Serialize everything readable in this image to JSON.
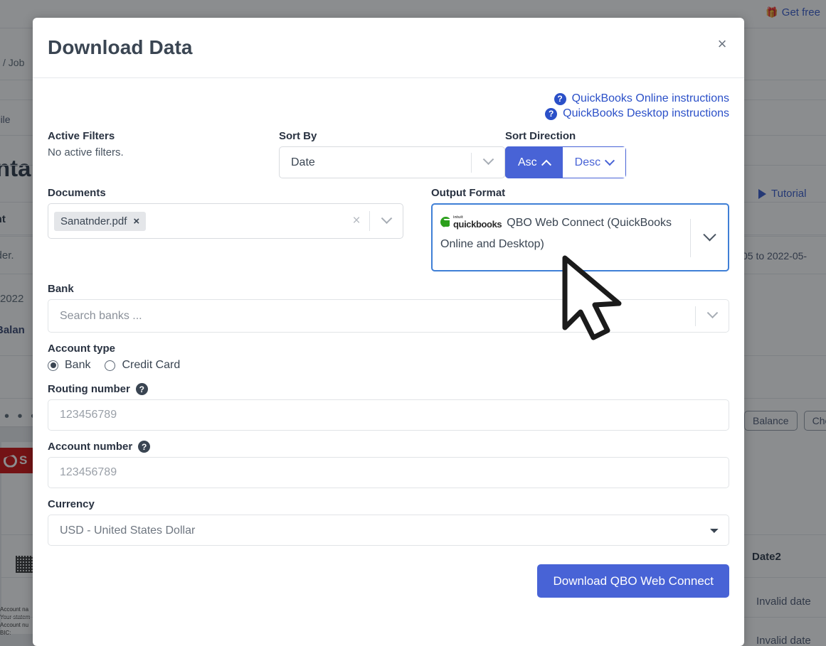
{
  "background": {
    "get_free_label": "Get free",
    "gift_icon": "gift-icon",
    "breadcrumb": "/ Job",
    "reconcile_label": "oncile",
    "big_title": "nta",
    "document_word": "ment",
    "document_name": "tnder.",
    "year": "2022",
    "balance_word": "Balan",
    "overflow_dots": "• • •",
    "santander_logo_text": "S",
    "account_lines": "Account na\nYour statem\nAccount nu\nBIC:",
    "tutorial_label": "Tutorial",
    "play_icon": "play-icon",
    "date_range": "05 to 2022-05-",
    "pills": [
      "Balance",
      "Che"
    ],
    "table_header_date2": "Date2",
    "table_rows": [
      "Invalid date",
      "Invalid date"
    ]
  },
  "modal": {
    "title": "Download Data",
    "close_icon": "×",
    "instructions": [
      {
        "icon": "help-circle-icon",
        "label": "QuickBooks Online instructions"
      },
      {
        "icon": "help-circle-icon",
        "label": "QuickBooks Desktop instructions"
      }
    ],
    "active_filters": {
      "label": "Active Filters",
      "value": "No active filters."
    },
    "sort_by": {
      "label": "Sort By",
      "value": "Date",
      "caret_icon": "chevron-down-icon"
    },
    "sort_direction": {
      "label": "Sort Direction",
      "asc_label": "Asc",
      "desc_label": "Desc",
      "selected": "Asc",
      "asc_icon": "chevron-up-icon",
      "desc_icon": "chevron-down-icon"
    },
    "documents": {
      "label": "Documents",
      "chips": [
        {
          "name": "Sanatnder.pdf",
          "remove_icon": "×"
        }
      ],
      "clear_icon": "×",
      "caret_icon": "chevron-down-icon"
    },
    "output_format": {
      "label": "Output Format",
      "logo_intuit": "intuit",
      "logo_quickbooks": "quickbooks",
      "value": "QBO Web Connect (QuickBooks Online and Desktop)",
      "caret_icon": "chevron-down-icon"
    },
    "bank": {
      "label": "Bank",
      "placeholder": "Search banks ...",
      "value": "",
      "caret_icon": "chevron-down-icon"
    },
    "account_type": {
      "label": "Account type",
      "options": [
        {
          "label": "Bank",
          "selected": true
        },
        {
          "label": "Credit Card",
          "selected": false
        }
      ]
    },
    "routing_number": {
      "label": "Routing number",
      "help_icon": "help-circle-icon",
      "placeholder": "123456789",
      "value": ""
    },
    "account_number": {
      "label": "Account number",
      "help_icon": "help-circle-icon",
      "placeholder": "123456789",
      "value": ""
    },
    "currency": {
      "label": "Currency",
      "value": "USD - United States Dollar",
      "options": [
        "USD - United States Dollar"
      ]
    },
    "submit": {
      "label": "Download QBO Web Connect"
    }
  },
  "colors": {
    "accent_blue": "#4863d6",
    "link_blue": "#2b50c8",
    "focus_border": "#3f7fd6",
    "quickbooks_green": "#2ca01c",
    "santander_red": "#cc0000",
    "overlay": "rgba(33,37,41,0.52)"
  }
}
